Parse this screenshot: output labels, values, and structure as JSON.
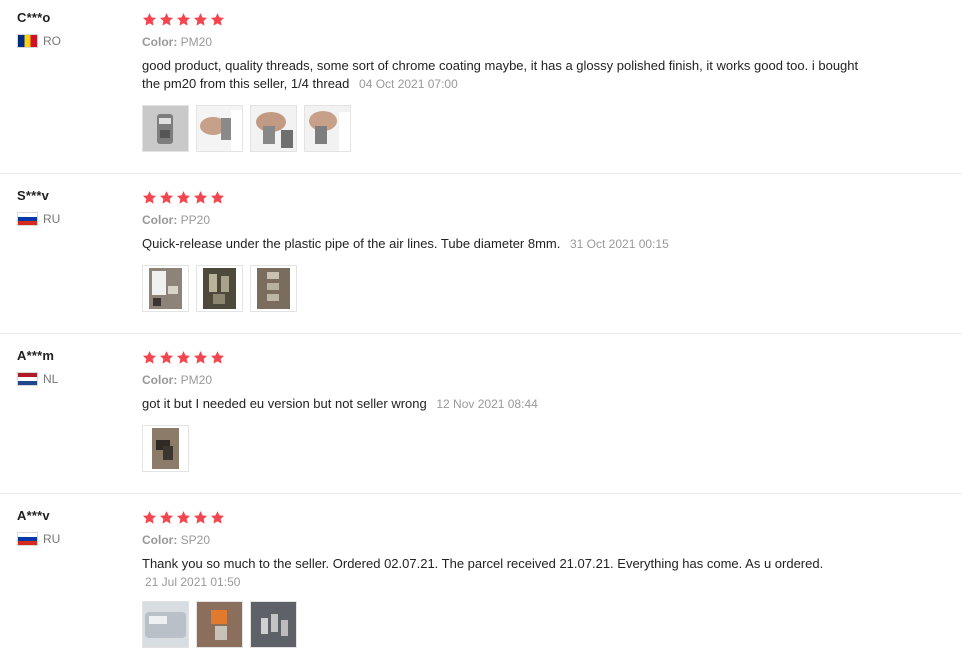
{
  "reviews": [
    {
      "user": "C***o",
      "country": "RO",
      "rating": 5,
      "color_label": "Color:",
      "color_value": "PM20",
      "text": "good product, quality threads, some sort of chrome coating maybe, it has a glossy polished finish, it works good too. i bought the pm20 from this seller, 1/4 thread",
      "date": "04 Oct 2021 07:00",
      "photos": [
        "product-photo-1",
        "product-photo-2",
        "product-photo-3",
        "product-photo-4"
      ]
    },
    {
      "user": "S***v",
      "country": "RU",
      "rating": 5,
      "color_label": "Color:",
      "color_value": "PP20",
      "text": "Quick-release under the plastic pipe of the air lines. Tube diameter 8mm.",
      "date": "31 Oct 2021 00:15",
      "photos": [
        "product-photo-1",
        "product-photo-2",
        "product-photo-3"
      ]
    },
    {
      "user": "A***m",
      "country": "NL",
      "rating": 5,
      "color_label": "Color:",
      "color_value": "PM20",
      "text": "got it but I needed eu version but not seller wrong",
      "date": "12 Nov 2021 08:44",
      "photos": [
        "product-photo-1"
      ]
    },
    {
      "user": "A***v",
      "country": "RU",
      "rating": 5,
      "color_label": "Color:",
      "color_value": "SP20",
      "text": "Thank you so much to the seller. Ordered 02.07.21. The parcel received 21.07.21. Everything has come. As u ordered.",
      "date": "21 Jul 2021 01:50",
      "photos": [
        "product-photo-1",
        "product-photo-2",
        "product-photo-3"
      ]
    }
  ],
  "colors": {
    "star": "#f5454e",
    "meta": "#999999",
    "divider": "#ececec"
  }
}
